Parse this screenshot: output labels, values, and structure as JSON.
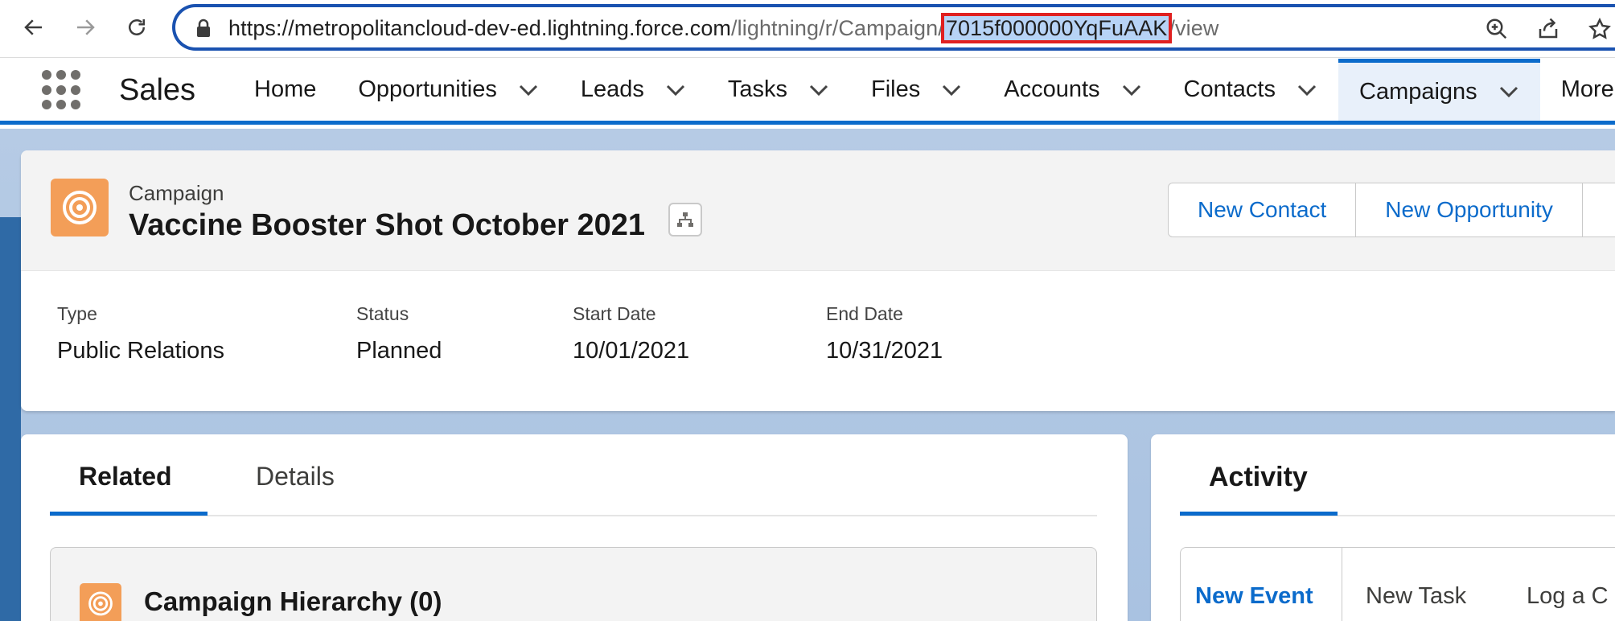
{
  "browser": {
    "url_host": "https://metropolitancloud-dev-ed.lightning.force.com",
    "url_path": "/lightning/r/Campaign/",
    "url_highlight": "7015f000000YqFuAAK",
    "url_tail": "/view",
    "icons": [
      "back-icon",
      "forward-icon",
      "reload-icon",
      "lock-icon",
      "zoom-icon",
      "share-icon",
      "star-icon"
    ]
  },
  "nav": {
    "app_name": "Sales",
    "tabs": [
      {
        "label": "Home",
        "has_menu": false
      },
      {
        "label": "Opportunities",
        "has_menu": true
      },
      {
        "label": "Leads",
        "has_menu": true
      },
      {
        "label": "Tasks",
        "has_menu": true
      },
      {
        "label": "Files",
        "has_menu": true
      },
      {
        "label": "Accounts",
        "has_menu": true
      },
      {
        "label": "Contacts",
        "has_menu": true
      },
      {
        "label": "Campaigns",
        "has_menu": true,
        "active": true
      },
      {
        "label": "More",
        "has_menu": false
      }
    ]
  },
  "record": {
    "object_label": "Campaign",
    "title": "Vaccine Booster Shot October 2021",
    "actions": [
      "New Contact",
      "New Opportunity"
    ],
    "fields": [
      {
        "label": "Type",
        "value": "Public Relations"
      },
      {
        "label": "Status",
        "value": "Planned"
      },
      {
        "label": "Start Date",
        "value": "10/01/2021"
      },
      {
        "label": "End Date",
        "value": "10/31/2021"
      }
    ]
  },
  "related": {
    "tabs": [
      "Related",
      "Details"
    ],
    "active_tab": "Related",
    "card_title": "Campaign Hierarchy (0)"
  },
  "activity": {
    "title": "Activity",
    "publisher_tabs": [
      "New Event",
      "New Task",
      "Log a C"
    ]
  },
  "colors": {
    "brand": "#0b6bcb",
    "campaign_icon": "#f39e58",
    "highlight_box": "#e02020"
  }
}
